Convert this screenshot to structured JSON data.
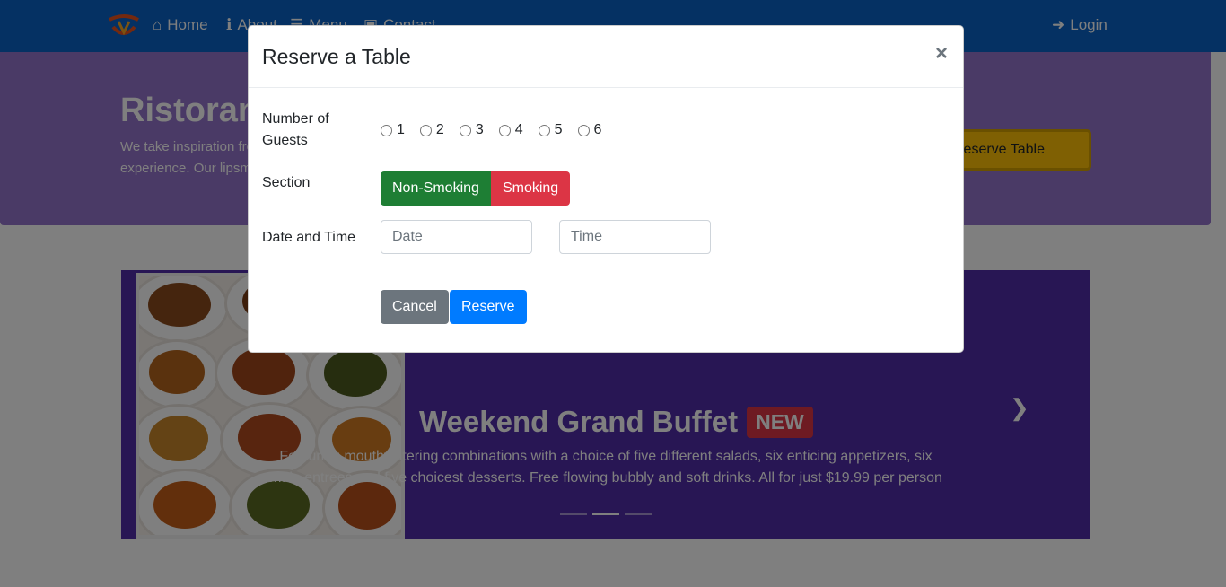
{
  "navbar": {
    "items": [
      {
        "label": "Home",
        "icon": "home-icon"
      },
      {
        "label": "About",
        "icon": "info-icon"
      },
      {
        "label": "Menu",
        "icon": "list-icon"
      },
      {
        "label": "Contact",
        "icon": "address-card-icon"
      }
    ],
    "login_label": "Login",
    "color": "#0b63c6"
  },
  "jumbotron": {
    "title": "Ristorante Con Fusion",
    "text": "We take inspiration from the World's best cuisines, and create a unique fusion experience. Our lipsmacking creations will tickle your culinary senses!",
    "reserve_button": "Reserve Table",
    "color": "#9575cd"
  },
  "carousel": {
    "title": "Weekend Grand Buffet",
    "badge": "NEW",
    "description": "Featuring mouthwatering combinations with a choice of five different salads, six enticing appetizers, six main entrees and five choicest desserts. Free flowing bubbly and soft drinks. All for just $19.99 per person",
    "active_slide": 2,
    "slide_count": 3,
    "color": "#512da8"
  },
  "modal": {
    "title": "Reserve a Table",
    "close_label": "×",
    "guests_label": "Number of Guests",
    "guest_options": [
      "1",
      "2",
      "3",
      "4",
      "5",
      "6"
    ],
    "section_label": "Section",
    "section_options": {
      "non_smoking": "Non-Smoking",
      "smoking": "Smoking"
    },
    "datetime_label": "Date and Time",
    "date_placeholder": "Date",
    "time_placeholder": "Time",
    "cancel_label": "Cancel",
    "reserve_label": "Reserve"
  }
}
